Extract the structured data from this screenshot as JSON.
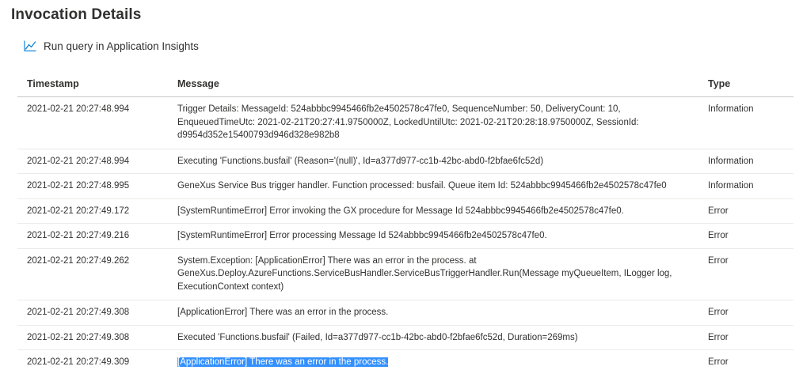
{
  "page": {
    "title": "Invocation Details",
    "query_link_label": "Run query in Application Insights",
    "query_icon": "line-chart-icon",
    "accent": "#0078d4"
  },
  "table": {
    "columns": [
      "Timestamp",
      "Message",
      "Type"
    ],
    "rows": [
      {
        "timestamp": "2021-02-21 20:27:48.994",
        "message": "Trigger Details: MessageId: 524abbbc9945466fb2e4502578c47fe0, SequenceNumber: 50, DeliveryCount: 10, EnqueuedTimeUtc: 2021-02-21T20:27:41.9750000Z, LockedUntilUtc: 2021-02-21T20:28:18.9750000Z, SessionId: d9954d352e15400793d946d328e982b8",
        "type": "Information"
      },
      {
        "timestamp": "2021-02-21 20:27:48.994",
        "message": "Executing 'Functions.busfail' (Reason='(null)', Id=a377d977-cc1b-42bc-abd0-f2bfae6fc52d)",
        "type": "Information"
      },
      {
        "timestamp": "2021-02-21 20:27:48.995",
        "message": "GeneXus Service Bus trigger handler. Function processed: busfail. Queue item Id: 524abbbc9945466fb2e4502578c47fe0",
        "type": "Information"
      },
      {
        "timestamp": "2021-02-21 20:27:49.172",
        "message": "[SystemRuntimeError] Error invoking the GX procedure for Message Id 524abbbc9945466fb2e4502578c47fe0.",
        "type": "Error"
      },
      {
        "timestamp": "2021-02-21 20:27:49.216",
        "message": "[SystemRuntimeError] Error processing Message Id 524abbbc9945466fb2e4502578c47fe0.",
        "type": "Error"
      },
      {
        "timestamp": "2021-02-21 20:27:49.262",
        "message": "System.Exception: [ApplicationError] There was an error in the process. at GeneXus.Deploy.AzureFunctions.ServiceBusHandler.ServiceBusTriggerHandler.Run(Message myQueueItem, ILogger log, ExecutionContext context)",
        "type": "Error"
      },
      {
        "timestamp": "2021-02-21 20:27:49.308",
        "message": "[ApplicationError] There was an error in the process.",
        "type": "Error"
      },
      {
        "timestamp": "2021-02-21 20:27:49.308",
        "message": "Executed 'Functions.busfail' (Failed, Id=a377d977-cc1b-42bc-abd0-f2bfae6fc52d, Duration=269ms)",
        "type": "Error"
      },
      {
        "timestamp": "2021-02-21 20:27:49.309",
        "message": "[ApplicationError] There was an error in the process.",
        "type": "Error",
        "selected": true
      }
    ]
  }
}
